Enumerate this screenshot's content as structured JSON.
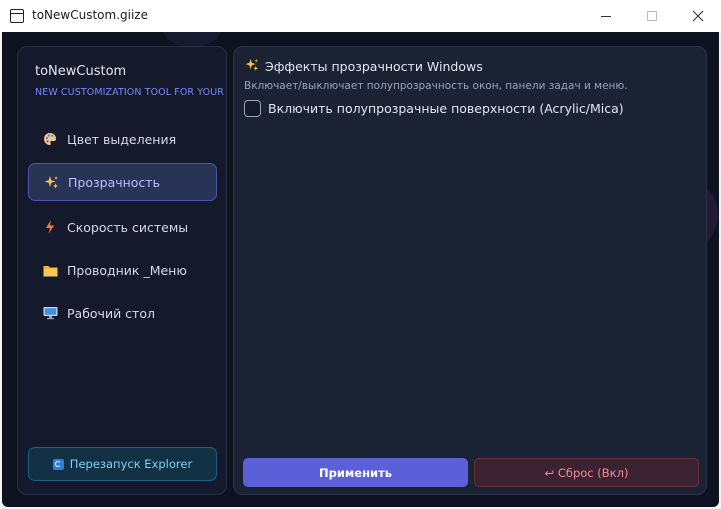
{
  "window": {
    "title": "toNewCustom.giize"
  },
  "sidebar": {
    "brand": "toNewCustom",
    "tagline": "NEW CUSTOMIZATION TOOL FOR YOUR",
    "items": [
      {
        "label": "Цвет выделения",
        "icon": "palette-icon",
        "active": false
      },
      {
        "label": "Прозрачность",
        "icon": "sparkles-icon",
        "active": true
      },
      {
        "label": "Скорость системы",
        "icon": "lightning-icon",
        "active": false
      },
      {
        "label": "Проводник _Меню",
        "icon": "folder-icon",
        "active": false
      },
      {
        "label": "Рабочий стол",
        "icon": "monitor-icon",
        "active": false
      }
    ],
    "restart_label": "Перезапуск Explorer"
  },
  "panel": {
    "title": "Эффекты прозрачности Windows",
    "description": "Включает/выключает полупрозрачность окон, панели задач и меню.",
    "checkbox_label": "Включить полупрозрачные поверхности (Acrylic/Mica)",
    "checkbox_checked": false,
    "apply_label": "Применить",
    "reset_label": "↩ Сброс (Вкл)"
  },
  "colors": {
    "accent": "#5b5fd8",
    "sidebar_active": "#293355",
    "restart": "#7fd0f2",
    "reset": "#f08a98"
  }
}
